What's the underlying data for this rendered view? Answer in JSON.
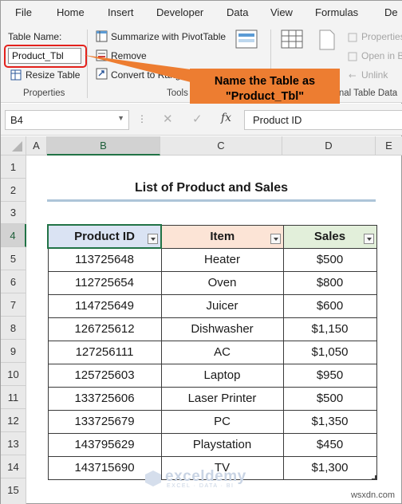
{
  "menu": [
    "File",
    "Home",
    "Insert",
    "Developer",
    "Data",
    "View",
    "Formulas",
    "De"
  ],
  "ribbon": {
    "table_name_label": "Table Name:",
    "table_name_value": "Product_Tbl",
    "resize_table": "Resize Table",
    "summarize_pivot": "Summarize with PivotTable",
    "remove_duplicates": "Remove",
    "convert_to_range": "Convert to Range",
    "properties": "Properties",
    "open_in_browser": "Open in B",
    "unlink": "Unlink",
    "groups": {
      "properties": "Properties",
      "tools": "Tools",
      "external": "External Table Data"
    },
    "callout": [
      "Name the Table as",
      "\"Product_Tbl\""
    ]
  },
  "formula_bar": {
    "name_box": "B4",
    "formula": "Product ID",
    "fx": "fx"
  },
  "columns": [
    "A",
    "B",
    "C",
    "D",
    "E"
  ],
  "rows": [
    "1",
    "2",
    "3",
    "4",
    "5",
    "6",
    "7",
    "8",
    "9",
    "10",
    "11",
    "12",
    "13",
    "14",
    "15"
  ],
  "sheet": {
    "title": "List of Product and Sales",
    "headers": [
      "Product ID",
      "Item",
      "Sales"
    ],
    "records": [
      [
        "113725648",
        "Heater",
        "$500"
      ],
      [
        "112725654",
        "Oven",
        "$800"
      ],
      [
        "114725649",
        "Juicer",
        "$600"
      ],
      [
        "126725612",
        "Dishwasher",
        "$1,150"
      ],
      [
        "127256111",
        "AC",
        "$1,050"
      ],
      [
        "125725603",
        "Laptop",
        "$950"
      ],
      [
        "133725606",
        "Laser Printer",
        "$500"
      ],
      [
        "133725679",
        "PC",
        "$1,350"
      ],
      [
        "143795629",
        "Playstation",
        "$450"
      ],
      [
        "143715690",
        "TV",
        "$1,300"
      ]
    ]
  },
  "watermark": {
    "name": "exceldemy",
    "tagline": "EXCEL · DATA · BI"
  },
  "credit": "wsxdn.com"
}
